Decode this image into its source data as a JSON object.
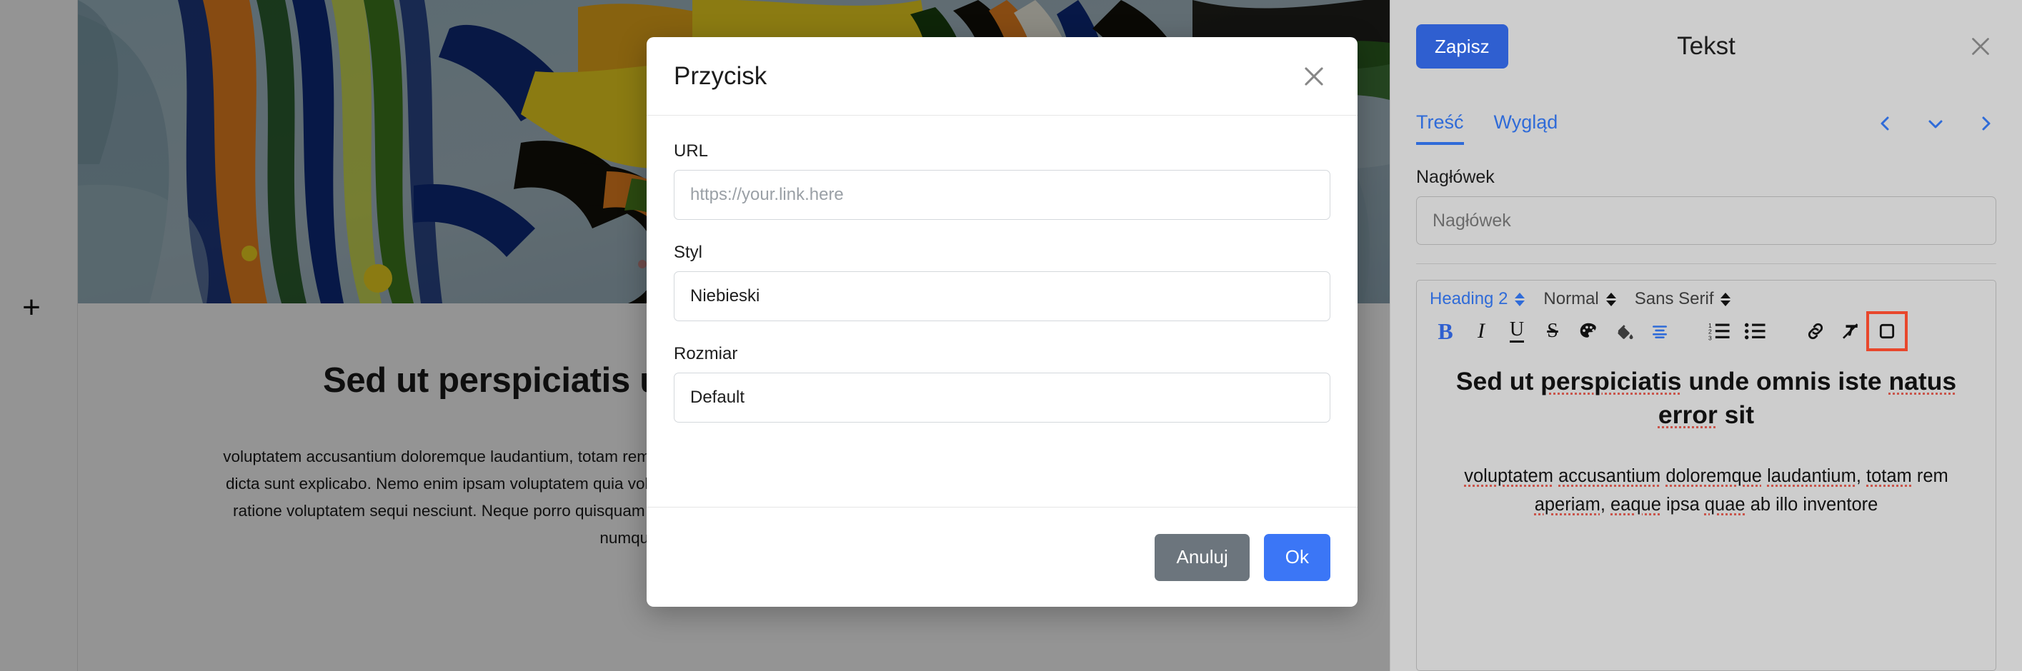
{
  "canvas": {
    "add_block_label": "+",
    "heading": "Sed ut perspiciatis unde omnis iste natus error sit",
    "paragraph": "voluptatem accusantium doloremque laudantium, totam rem aperiam, eaque ipsa quae ab illo inventore veritatis et quasi architecto beatae vitae dicta sunt explicabo. Nemo enim ipsam voluptatem quia voluptas sit aspernatur aut odit aut fugit, sed quia consequuntur magni dolores eos qui ratione voluptatem sequi nesciunt. Neque porro quisquam est, qui dolorem ipsum quia dolor sit amet, consectetur, adipisci velit, sed quia non numquam eius modi tempora incidunt"
  },
  "modal": {
    "title": "Przycisk",
    "close_icon": "close-icon",
    "fields": [
      {
        "label": "URL",
        "value": "",
        "placeholder": "https://your.link.here"
      },
      {
        "label": "Styl",
        "value": "Niebieski",
        "placeholder": ""
      },
      {
        "label": "Rozmiar",
        "value": "Default",
        "placeholder": ""
      }
    ],
    "cancel_label": "Anuluj",
    "ok_label": "Ok",
    "cancel_color": "#6c757d",
    "ok_color": "#3b76f6"
  },
  "sidebar": {
    "save_label": "Zapisz",
    "save_color": "#2f5fd0",
    "title": "Tekst",
    "close_icon": "close-icon",
    "tabs": [
      {
        "label": "Treść",
        "active": true
      },
      {
        "label": "Wygląd",
        "active": false
      }
    ],
    "nav": [
      {
        "icon": "chevron-left-icon"
      },
      {
        "icon": "chevron-down-icon"
      },
      {
        "icon": "chevron-right-icon"
      }
    ],
    "accent_color": "#2f6bd8",
    "heading_field": {
      "label": "Nagłówek",
      "value": "",
      "placeholder": "Nagłówek"
    },
    "toolbar": {
      "selects": [
        {
          "label": "Heading 2",
          "style": "blue"
        },
        {
          "label": "Normal",
          "style": "dark"
        },
        {
          "label": "Sans Serif",
          "style": "dark"
        }
      ],
      "buttons": [
        {
          "name": "bold-icon",
          "label": "B",
          "active": true
        },
        {
          "name": "italic-icon",
          "label": "I",
          "active": false
        },
        {
          "name": "underline-icon",
          "label": "U",
          "active": false
        },
        {
          "name": "strikethrough-icon",
          "label": "S",
          "active": false
        },
        {
          "name": "text-color-palette-icon",
          "label": "",
          "active": false
        },
        {
          "name": "background-fill-icon",
          "label": "",
          "active": false
        },
        {
          "name": "align-icon",
          "label": "",
          "active": false
        },
        {
          "name": "ordered-list-icon",
          "label": "",
          "active": false
        },
        {
          "name": "bullet-list-icon",
          "label": "",
          "active": false
        },
        {
          "name": "link-icon",
          "label": "",
          "active": false
        },
        {
          "name": "clear-format-icon",
          "label": "",
          "active": false
        },
        {
          "name": "insert-button-icon",
          "label": "",
          "active": false,
          "selected": true
        }
      ],
      "selection_color": "#e8472c"
    },
    "editor": {
      "heading": "Sed ut perspiciatis unde omnis iste natus error sit",
      "paragraph": "voluptatem accusantium doloremque laudantium, totam rem aperiam, eaque ipsa quae ab illo inventore"
    }
  }
}
